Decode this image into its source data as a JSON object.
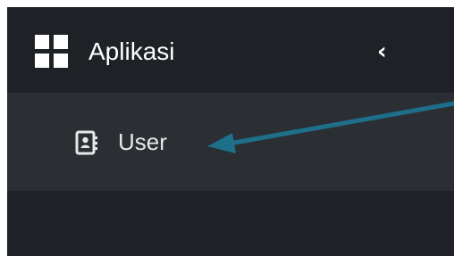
{
  "menu": {
    "title": "Aplikasi",
    "items": [
      {
        "label": "User"
      }
    ]
  },
  "icons": {
    "menu_icon": "grid-icon",
    "collapse_icon": "chevron-left-icon",
    "item_icon": "contact-card-icon"
  },
  "colors": {
    "header_bg": "#1e2125",
    "submenu_bg": "#2b2f34",
    "text": "#ffffff",
    "annotation_arrow": "#1e6f8a"
  }
}
